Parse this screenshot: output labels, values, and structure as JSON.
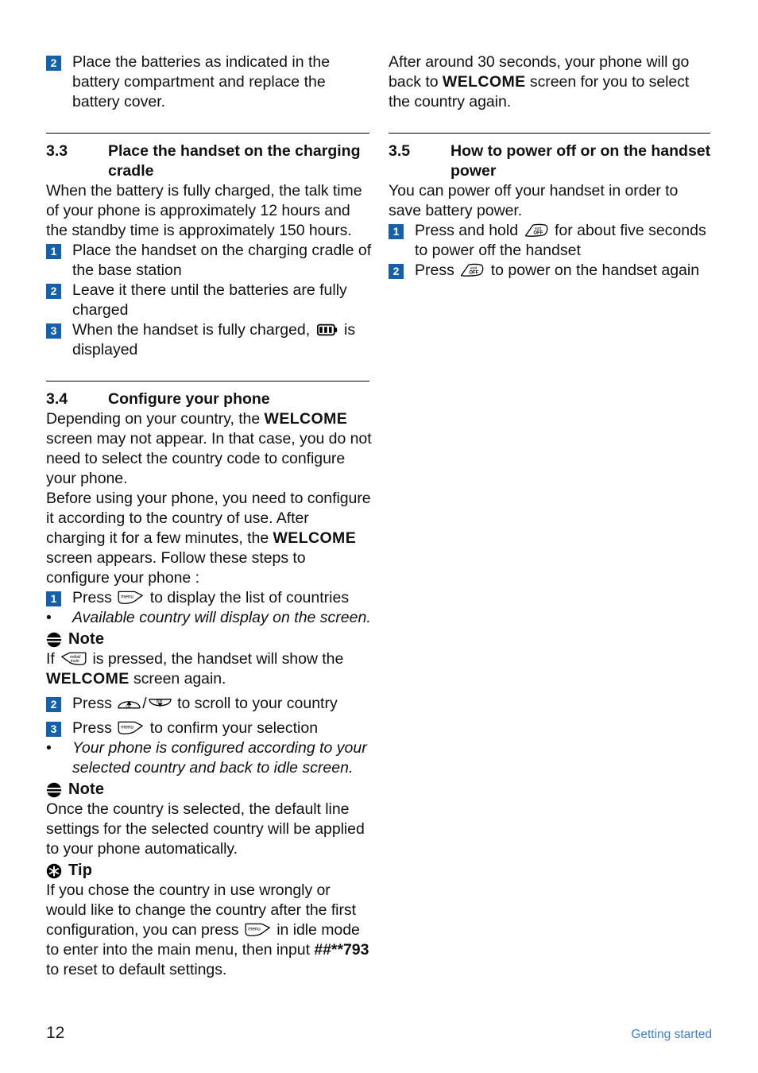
{
  "page": {
    "folio": "12",
    "running_head": "Getting started",
    "accent_blue": "#1560ab",
    "runhead_blue": "#3f7fd0"
  },
  "left_column": {
    "step_intro": {
      "number": "2",
      "text": "Place the batteries as indicated in the battery compartment and replace the battery cover."
    },
    "section_33": {
      "number": "3.3",
      "title": "Place the handset on the charging cradle",
      "intro": "When the battery is fully charged, the talk time of your phone is approximately 12 hours and the standby time is approximately 150 hours.",
      "steps": [
        {
          "number": "1",
          "text": "Place the handset on the charging cradle of the base station"
        },
        {
          "number": "2",
          "text": "Leave it there until the batteries are fully charged"
        },
        {
          "number": "3",
          "text_before": "When the handset is fully charged,",
          "icon": "battery-full-icon",
          "text_after": "is displayed"
        }
      ]
    },
    "section_34": {
      "number": "3.4",
      "title": "Configure your phone",
      "para1_a": "Depending on your country, the ",
      "para1_welcome": "WELCOME",
      "para1_b": " screen may not appear. In that case, you do not need to select the country code to configure your phone.",
      "para2_a": "Before using your phone, you need to configure it according to the country of use. After charging it for a few minutes, the ",
      "para2_welcome": "WELCOME",
      "para2_b": " screen appears. Follow these steps to configure your phone :",
      "step1": {
        "number": "1",
        "text_before": "Press",
        "icon": "menu-softkey-icon",
        "text_after": "to display the list of countries"
      },
      "bullet1": "Available country will display on the screen.",
      "note1": {
        "icon": "note-icon",
        "label": "Note",
        "text_before": "If",
        "key_icon": "redial-mute-key-icon",
        "text_mid": "is pressed, the handset will show the ",
        "welcome": "WELCOME",
        "text_after": " screen again."
      },
      "step2": {
        "number": "2",
        "text_before": "Press",
        "icon_up": "nav-up-cid-key-icon",
        "separator": "/",
        "icon_down": "nav-down-pbk-key-icon",
        "text_after": "to scroll to your country"
      },
      "step3": {
        "number": "3",
        "text_before": "Press",
        "icon": "menu-softkey-icon",
        "text_after": "to confirm your selection"
      },
      "bullet2": "Your phone is configured according to your selected country and back to idle screen.",
      "note2": {
        "icon": "note-icon",
        "label": "Note",
        "text": "Once the country is selected, the default line settings for the selected country will be applied to your phone automatically."
      },
      "tip": {
        "icon": "tip-icon",
        "label": "Tip",
        "text_a": "If you chose the country in use wrongly or would like to change the country after the first configuration, you can press",
        "key_icon": "menu-softkey-icon",
        "text_b": "in idle mode to enter into the main menu, then input ",
        "code": "##**793",
        "text_c": " to reset to default settings."
      }
    }
  },
  "right_column": {
    "continuation": {
      "text_a": "After around 30 seconds, your phone will go back to ",
      "welcome": "WELCOME",
      "text_b": " screen for you to select the country again."
    },
    "section_35": {
      "number": "3.5",
      "title": "How to power off or on the handset power",
      "intro": "You can power off your handset in order to save battery power.",
      "step1": {
        "number": "1",
        "text_before": "Press and hold",
        "icon": "exit-off-key-icon",
        "text_after": "for about five seconds to power off the handset"
      },
      "step2": {
        "number": "2",
        "text_before": "Press",
        "icon": "exit-off-key-icon",
        "text_after": "to power on the handset again"
      }
    }
  }
}
